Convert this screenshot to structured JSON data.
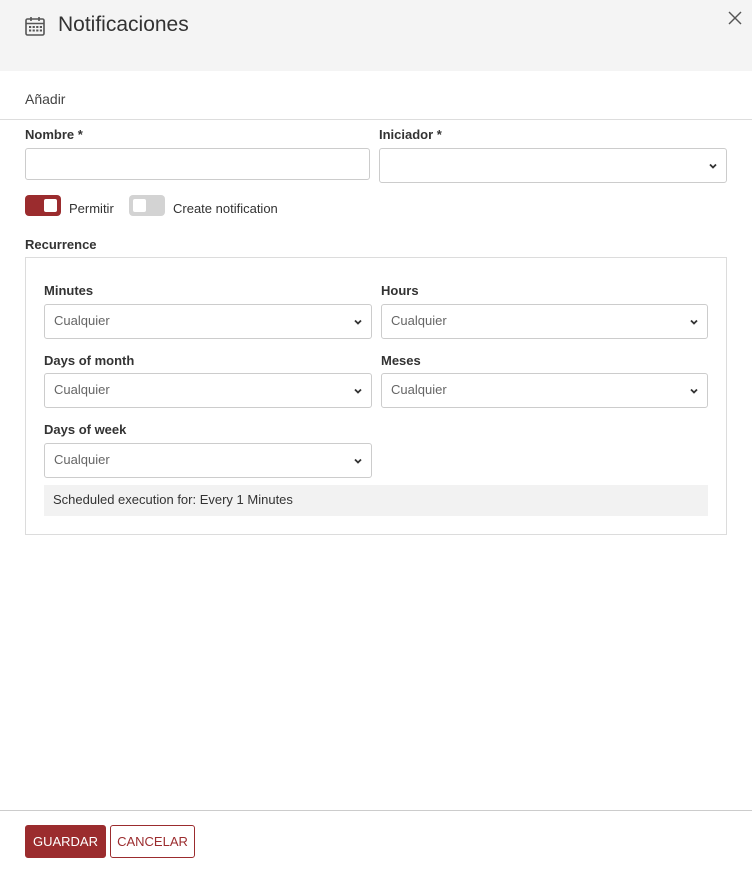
{
  "dialog": {
    "title": "Notificaciones",
    "icon": "calendar-icon",
    "close_icon": "close-icon"
  },
  "section": {
    "subtitle": "Añadir"
  },
  "form": {
    "name_label": "Nombre *",
    "name_value": "",
    "initiator_label": "Iniciador *",
    "initiator_value": "",
    "allow_toggle": {
      "label": "Permitir",
      "on": true
    },
    "create_notification_toggle": {
      "label": "Create notification",
      "on": false
    }
  },
  "recurrence": {
    "label": "Recurrence",
    "minutes": {
      "label": "Minutes",
      "value": "Cualquier"
    },
    "hours": {
      "label": "Hours",
      "value": "Cualquier"
    },
    "days_of_month": {
      "label": "Days of month",
      "value": "Cualquier"
    },
    "months": {
      "label": "Meses",
      "value": "Cualquier"
    },
    "days_of_week": {
      "label": "Days of week",
      "value": "Cualquier"
    },
    "summary": "Scheduled execution for:  Every 1 Minutes"
  },
  "footer": {
    "save_label": "GUARDAR",
    "cancel_label": "CANCELAR"
  },
  "colors": {
    "accent": "#9b2c2e",
    "header_bg": "#f4f4f4",
    "toggle_off": "#d3d3d3"
  }
}
